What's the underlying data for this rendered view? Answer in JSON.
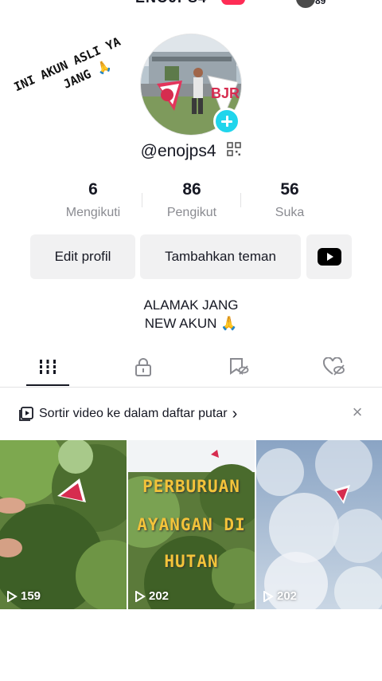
{
  "header": {
    "title_partial": "ENOJPS4",
    "count_partial": "89"
  },
  "overlay_caption": {
    "line1": "INI AKUN ASLI YA",
    "line2": "JANG 🙏"
  },
  "profile": {
    "username": "@enojps4"
  },
  "stats": [
    {
      "value": "6",
      "label": "Mengikuti"
    },
    {
      "value": "86",
      "label": "Pengikut"
    },
    {
      "value": "56",
      "label": "Suka"
    }
  ],
  "actions": {
    "edit": "Edit profil",
    "add_friends": "Tambahkan teman"
  },
  "bio": {
    "line1": "ALAMAK JANG",
    "line2": "NEW AKUN 🙏"
  },
  "tabs": [
    {
      "name": "videos",
      "icon": "grid-icon",
      "active": true
    },
    {
      "name": "private",
      "icon": "lock-icon"
    },
    {
      "name": "favorites",
      "icon": "bookmark-hidden-icon"
    },
    {
      "name": "liked",
      "icon": "heart-hidden-icon"
    }
  ],
  "sort_banner": {
    "text": "Sortir video ke dalam daftar putar",
    "chevron": "›",
    "close": "×"
  },
  "videos": [
    {
      "views": "159",
      "overlay_text": ""
    },
    {
      "views": "202",
      "overlay_text": "PERBURUAN LAYANGAN DI HUTAN",
      "lines": [
        "PERBURUAN",
        "AYANGAN DI",
        "HUTAN"
      ]
    },
    {
      "views": "202",
      "overlay_text": ""
    }
  ],
  "colors": {
    "accent_pink": "#fe2c55",
    "plus_cyan": "#20d5ec",
    "muted_text": "#8a8b91"
  }
}
